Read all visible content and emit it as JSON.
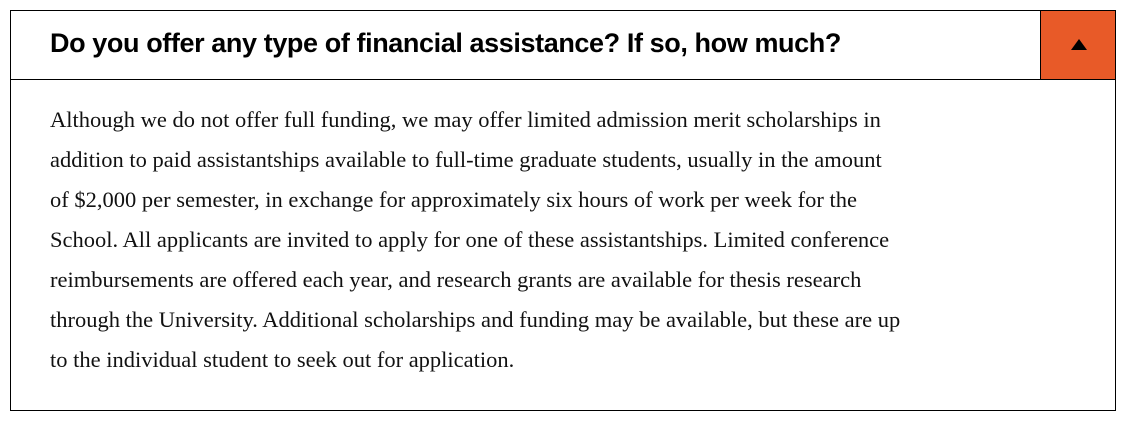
{
  "accordion": {
    "question": "Do you offer any type of financial assistance? If so, how much?",
    "toggle_icon": "caret-up-icon",
    "accent_color": "#E85A28",
    "expanded": true,
    "answer_lines": [
      "Although we do not offer full funding, we may offer limited admission merit scholarships in",
      "addition to paid assistantships available to full-time graduate students, usually in the amount",
      "of $2,000 per semester, in exchange for approximately six hours of work per week for the",
      "School. All applicants are invited to apply for one of these assistantships. Limited conference",
      "reimbursements are offered each year, and research grants are available for thesis research",
      "through the University. Additional scholarships and funding may be available, but these are up",
      "to the individual student to seek out for application."
    ]
  }
}
